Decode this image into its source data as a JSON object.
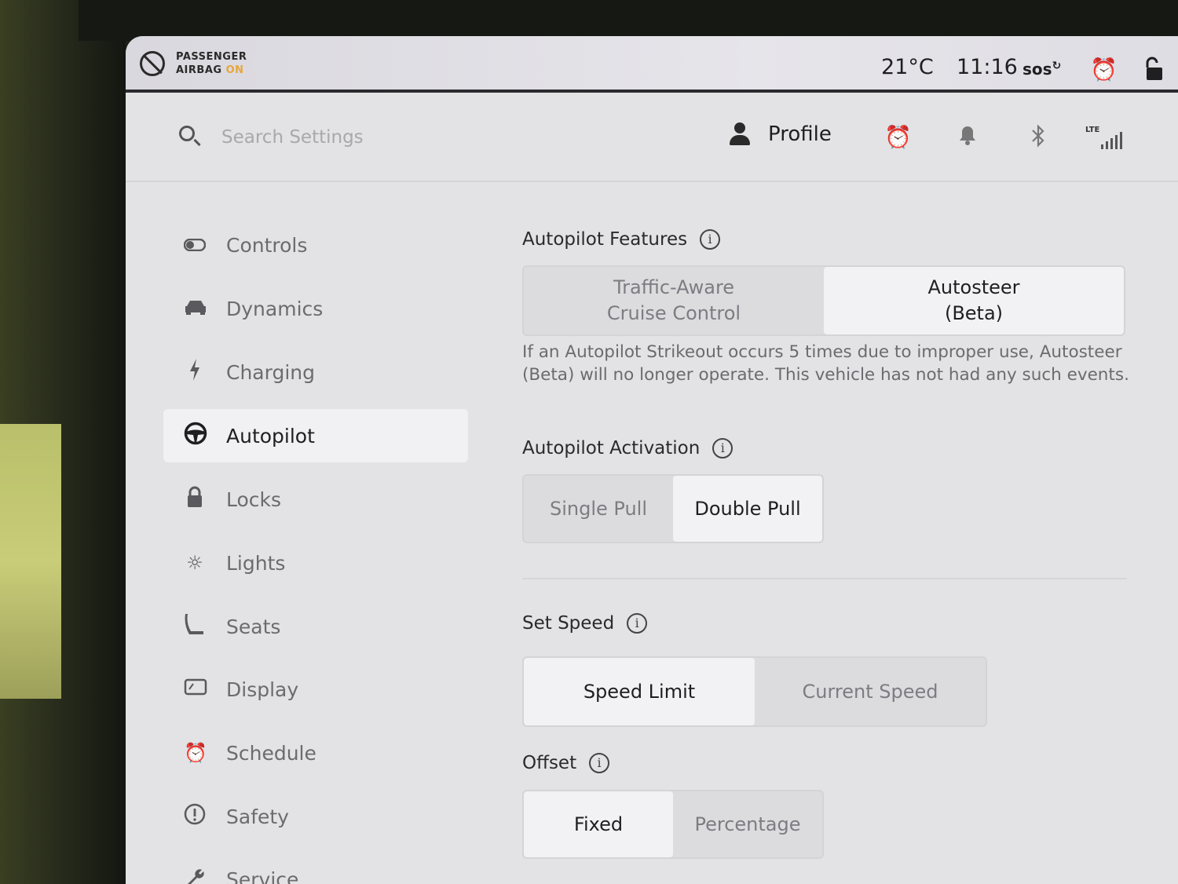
{
  "status_bar": {
    "airbag_line1": "PASSENGER",
    "airbag_line2": "AIRBAG",
    "airbag_state": "ON",
    "temperature": "21°C",
    "time": "11:16",
    "sos_label": "sos"
  },
  "header": {
    "search_placeholder": "Search Settings",
    "profile_label": "Profile",
    "lte_label": "LTE"
  },
  "sidebar": {
    "items": [
      {
        "label": "Controls",
        "icon": "toggle-icon"
      },
      {
        "label": "Dynamics",
        "icon": "car-icon"
      },
      {
        "label": "Charging",
        "icon": "lightning-icon"
      },
      {
        "label": "Autopilot",
        "icon": "steering-wheel-icon",
        "active": true
      },
      {
        "label": "Locks",
        "icon": "lock-icon"
      },
      {
        "label": "Lights",
        "icon": "sun-icon"
      },
      {
        "label": "Seats",
        "icon": "seat-icon"
      },
      {
        "label": "Display",
        "icon": "display-icon"
      },
      {
        "label": "Schedule",
        "icon": "alarm-clock-icon"
      },
      {
        "label": "Safety",
        "icon": "alert-circle-icon"
      },
      {
        "label": "Service",
        "icon": "wrench-icon"
      }
    ]
  },
  "main": {
    "autopilot_features": {
      "title": "Autopilot Features",
      "options": [
        "Traffic-Aware\nCruise Control",
        "Autosteer\n(Beta)"
      ],
      "selected": "Autosteer (Beta)"
    },
    "description": "If an Autopilot Strikeout occurs 5 times due to improper use, Autosteer (Beta) will no longer operate. This vehicle has not had any such events.",
    "autopilot_activation": {
      "title": "Autopilot Activation",
      "options": [
        "Single Pull",
        "Double Pull"
      ],
      "selected": "Double Pull"
    },
    "set_speed": {
      "title": "Set Speed",
      "options": [
        "Speed Limit",
        "Current Speed"
      ],
      "selected": "Speed Limit"
    },
    "offset": {
      "title": "Offset",
      "options": [
        "Fixed",
        "Percentage"
      ],
      "selected": "Fixed"
    }
  }
}
